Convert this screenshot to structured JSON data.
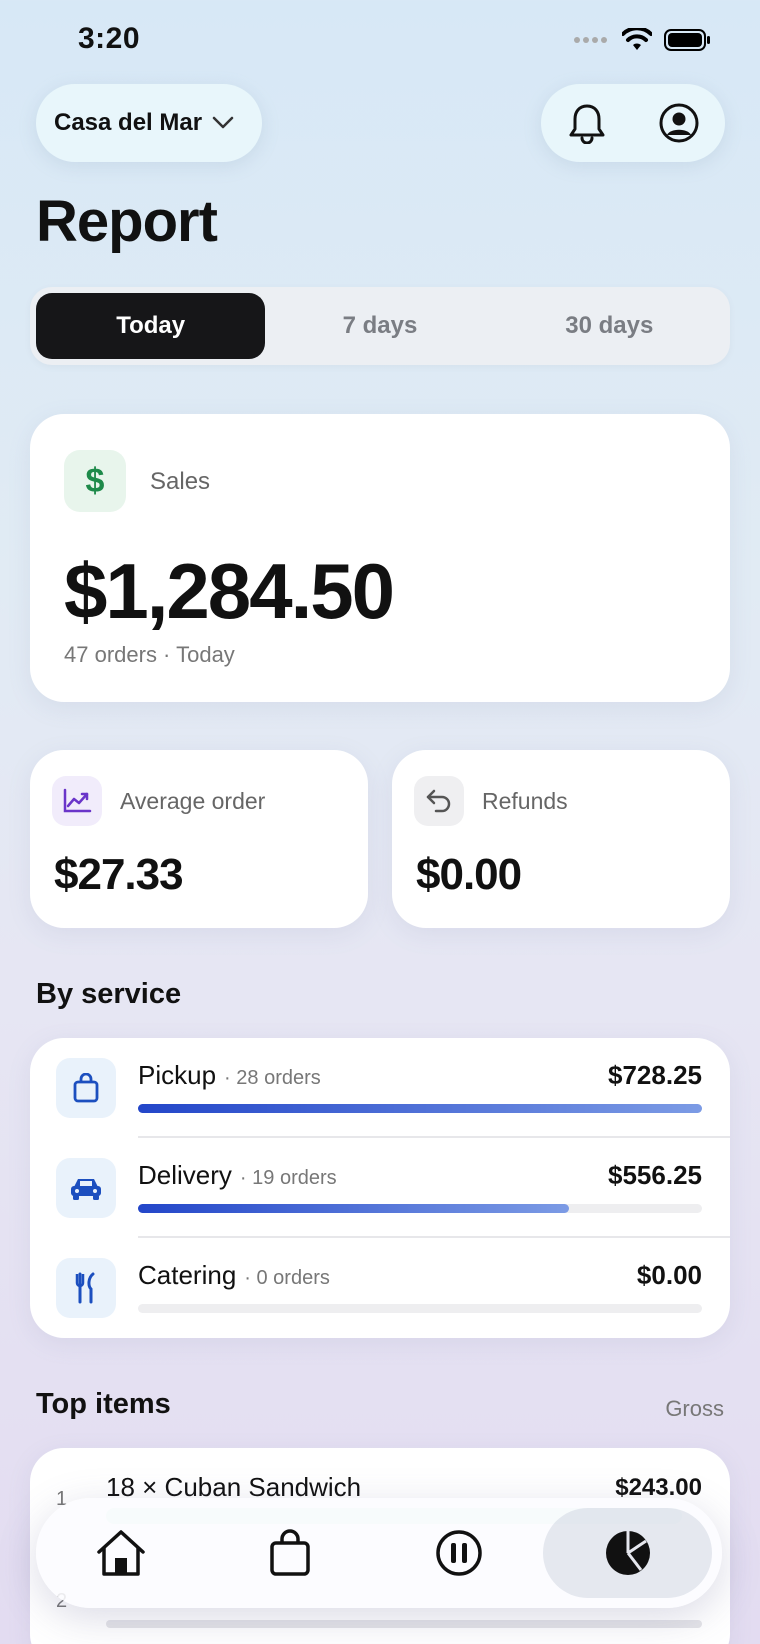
{
  "status_bar": {
    "time": "3:20"
  },
  "header": {
    "location": "Casa del Mar",
    "title": "Report"
  },
  "range_tabs": [
    {
      "label": "Today",
      "active": true
    },
    {
      "label": "7 days",
      "active": false
    },
    {
      "label": "30 days",
      "active": false
    }
  ],
  "sales": {
    "label": "Sales",
    "value": "$1,284.50",
    "subtitle": "47 orders · Today",
    "icon": "dollar-icon"
  },
  "average_order": {
    "label": "Average order",
    "value": "$27.33",
    "icon": "trend-chart-icon"
  },
  "refunds": {
    "label": "Refunds",
    "value": "$0.00",
    "icon": "undo-icon"
  },
  "by_service": {
    "title": "By service",
    "rows": [
      {
        "name": "Pickup",
        "count": "· 28 orders",
        "amount": "$728.25",
        "share": 1.0,
        "icon": "bag-icon"
      },
      {
        "name": "Delivery",
        "count": "· 19 orders",
        "amount": "$556.25",
        "share": 0.764,
        "icon": "car-icon"
      },
      {
        "name": "Catering",
        "count": "· 0 orders",
        "amount": "$0.00",
        "share": 0,
        "icon": "fork-knife-icon"
      }
    ]
  },
  "top_items": {
    "title": "Top items",
    "metric": "Gross",
    "items": [
      {
        "rank": "1",
        "name": "18 × Cuban Sandwich",
        "amount": "$243.00"
      },
      {
        "rank": "2",
        "name": "",
        "amount": ""
      }
    ]
  },
  "tab_bar": [
    {
      "icon": "home-icon",
      "active": false
    },
    {
      "icon": "shopping-bag-icon",
      "active": false
    },
    {
      "icon": "pause-circle-icon",
      "active": false
    },
    {
      "icon": "pie-chart-icon",
      "active": true
    }
  ],
  "colors": {
    "accent_bar": "#2346c9",
    "sales_icon": "#1e8a4a",
    "avg_icon": "#6a35c9"
  }
}
